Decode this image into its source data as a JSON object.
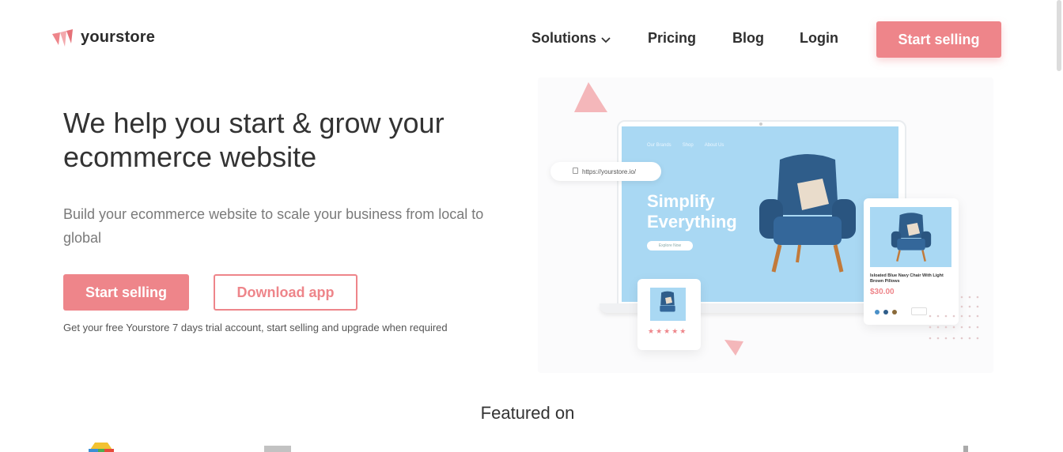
{
  "brand": {
    "name": "yourstore",
    "accent": "#ee858a"
  },
  "nav": {
    "items": [
      {
        "label": "Solutions",
        "has_dropdown": true
      },
      {
        "label": "Pricing"
      },
      {
        "label": "Blog"
      },
      {
        "label": "Login"
      }
    ],
    "cta": "Start selling"
  },
  "hero": {
    "title": "We help you start & grow your ecommerce website",
    "subtitle": "Build your ecommerce website to scale your business from local to global",
    "primary_cta": "Start selling",
    "secondary_cta": "Download app",
    "note": "Get your free Yourstore 7 days trial account, start selling and upgrade when required"
  },
  "illustration": {
    "url": "https://yourstore.io/",
    "mini_nav": [
      "Our Brands",
      "Shop",
      "About Us"
    ],
    "headline_line1": "Simplify",
    "headline_line2": "Everything",
    "explore_label": "Explore Now",
    "product_name": "Isloated Blue Navy Chair With Light Brown Pillows",
    "product_price": "$30.00",
    "stars": "★★★★★"
  },
  "featured": {
    "title": "Featured on"
  }
}
